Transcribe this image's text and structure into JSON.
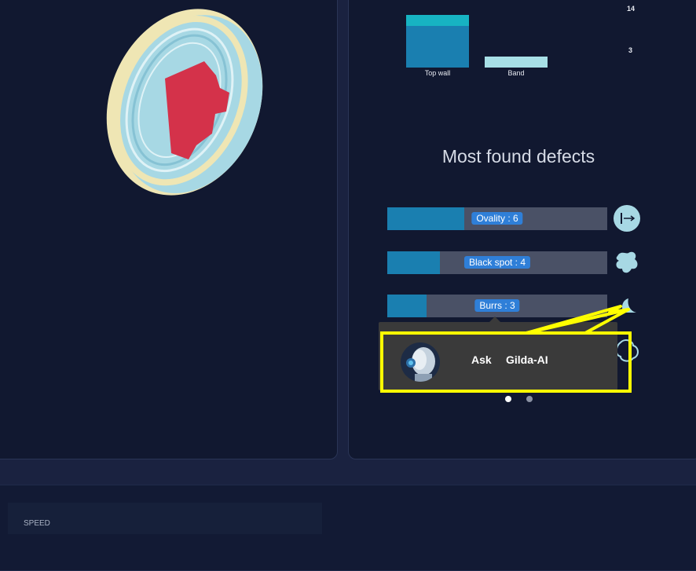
{
  "chart_data": {
    "type": "bar",
    "categories": [
      "Top wall",
      "Band"
    ],
    "series": [
      {
        "values": [
          11,
          3
        ],
        "color": "#1a7fb0"
      },
      {
        "values": [
          3,
          0
        ],
        "color": "#17b3c2"
      }
    ],
    "ticks": [
      "14",
      "3"
    ],
    "ylim": [
      0,
      14
    ]
  },
  "defects": {
    "title": "Most found defects",
    "items": [
      {
        "label": "Ovality : 6",
        "fill": 0.35,
        "icon": "ovality-icon"
      },
      {
        "label": "Black spot : 4",
        "fill": 0.24,
        "icon": "black-spot-icon"
      },
      {
        "label": "Burrs : 3",
        "fill": 0.18,
        "icon": "burrs-icon"
      }
    ]
  },
  "pager": {
    "count": 2,
    "active": 0
  },
  "assistant": {
    "ask": "Ask",
    "name": "Gilda-AI"
  },
  "speed": {
    "label": "SPEED"
  },
  "colors": {
    "accent": "#1a7fb0",
    "teal": "#17b3c2",
    "highlight": "#ffff00",
    "defect_red": "#d4324a",
    "tire_blue": "#a7d8e4",
    "tire_cream": "#efe6b4"
  }
}
